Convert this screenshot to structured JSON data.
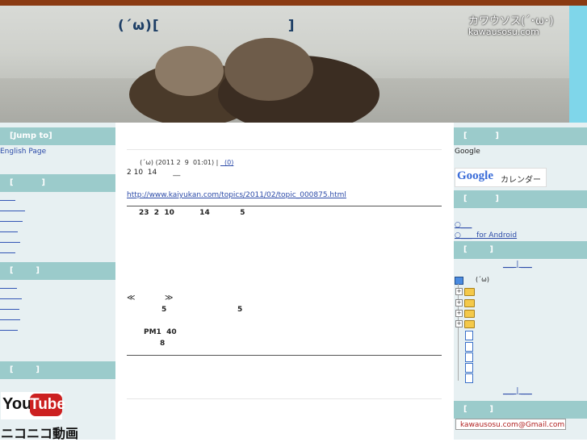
{
  "header": {
    "site_title": "(´ω)[                       ]",
    "logo_line1": "カワウソス(´･ω･)",
    "logo_line2": "kawausosu.com"
  },
  "left": {
    "jump_heading": "[Jump to]",
    "english_link": "English Page",
    "heading_2": "[          ]",
    "heading_3": "[        ]",
    "heading_4": "[        ]",
    "youtube_you": "You",
    "youtube_tube": "Tube",
    "nico": "ニコニコ動画"
  },
  "post": {
    "meta": "(´ω) (2011 2  9  01:01) | ",
    "comment_link": "  (0)",
    "line1": "2 10  14       __",
    "url": "http://www.kaiyukan.com/topics/2011/02/topic_000875.html",
    "bold_line": "23  2  10          14            5",
    "nav_prev": "≪",
    "nav_next": "≫",
    "row_a_left": "5",
    "row_a_right": "5",
    "time_line": "PM1  40",
    "row_b": "8"
  },
  "right": {
    "heading_1": "[          ]",
    "google_text": "Google",
    "gcal_google": "Google",
    "gcal_calendar": "カレンダー",
    "heading_2": "[          ]",
    "app_link_1": "○___",
    "app_link_2": "○___  for Android",
    "heading_3": "[        ]",
    "pager_top": "___ | ___",
    "tree_root": "(´ω)",
    "pager_bottom": "___ | ___",
    "heading_4": "[        ]",
    "mail": "kawausosu.com@Gmail.com"
  }
}
